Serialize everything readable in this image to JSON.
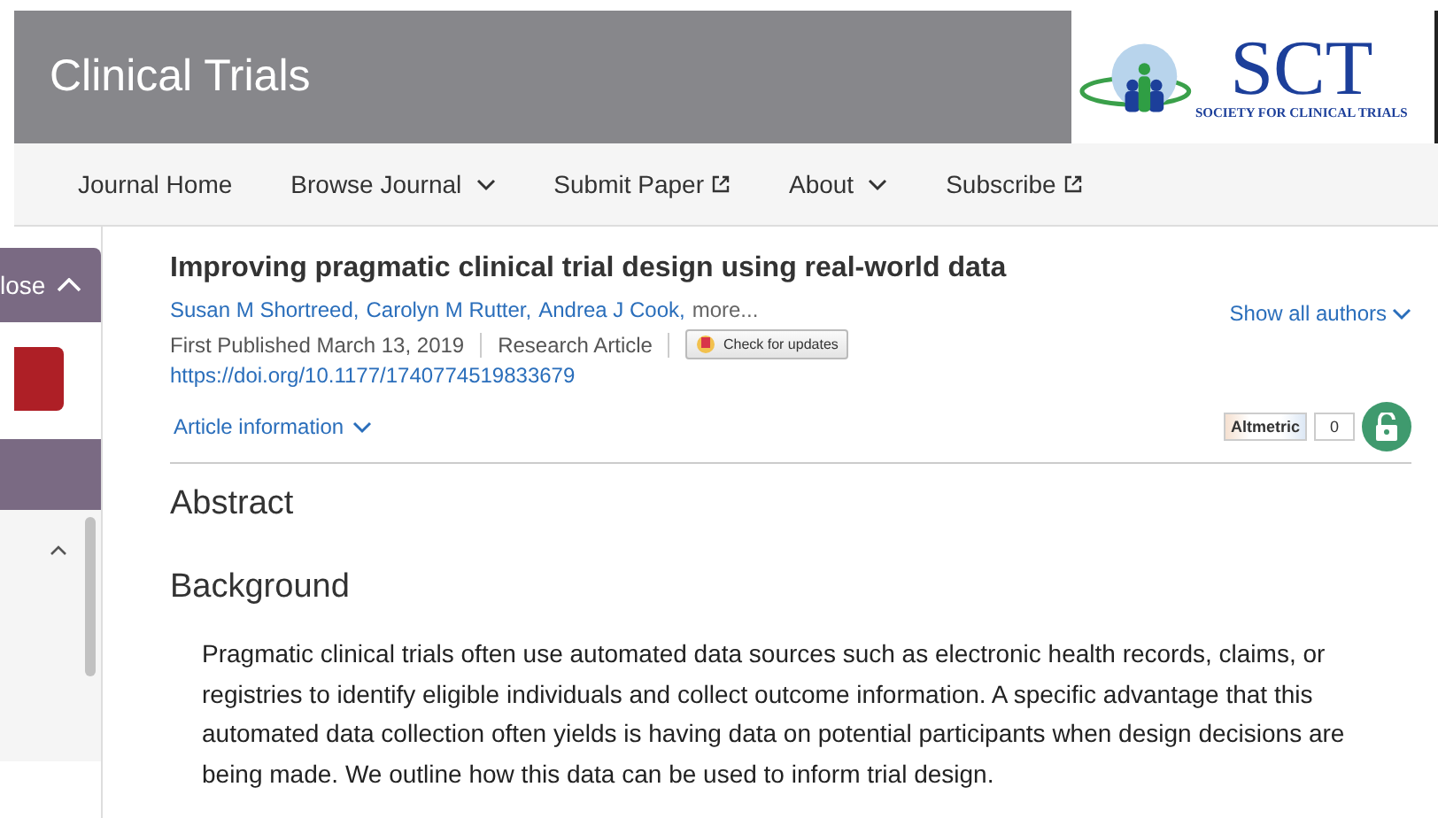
{
  "header": {
    "title": "Clinical Trials",
    "logo": {
      "mark": "SCT",
      "tagline": "SOCIETY FOR CLINICAL TRIALS"
    }
  },
  "nav": [
    {
      "label": "Journal Home",
      "kind": "plain"
    },
    {
      "label": "Browse Journal",
      "kind": "dropdown"
    },
    {
      "label": "Submit Paper",
      "kind": "external"
    },
    {
      "label": "About",
      "kind": "dropdown"
    },
    {
      "label": "Subscribe",
      "kind": "external"
    }
  ],
  "sidebar": {
    "toggle": "lose",
    "expanded": true
  },
  "article": {
    "title": "Improving pragmatic clinical trial design using real-world data",
    "authors": [
      "Susan M Shortreed,",
      "Carolyn M Rutter,",
      "Andrea J Cook,"
    ],
    "more": "more...",
    "show_all": "Show all authors",
    "published": "First Published March 13, 2019",
    "type": "Research Article",
    "updates": "Check for updates",
    "doi": "https://doi.org/10.1177/1740774519833679",
    "info": "Article information",
    "altmetric": "Altmetric",
    "altmetric_count": "0",
    "open_access": true
  },
  "abstract": {
    "heading": "Abstract",
    "sections": [
      {
        "heading": "Background",
        "text": "Pragmatic clinical trials often use automated data sources such as electronic health records, claims, or registries to identify eligible individuals and collect outcome information. A specific advantage that this automated data collection often yields is having data on potential participants when design decisions are being made. We outline how this data can be used to inform trial design."
      }
    ]
  }
}
